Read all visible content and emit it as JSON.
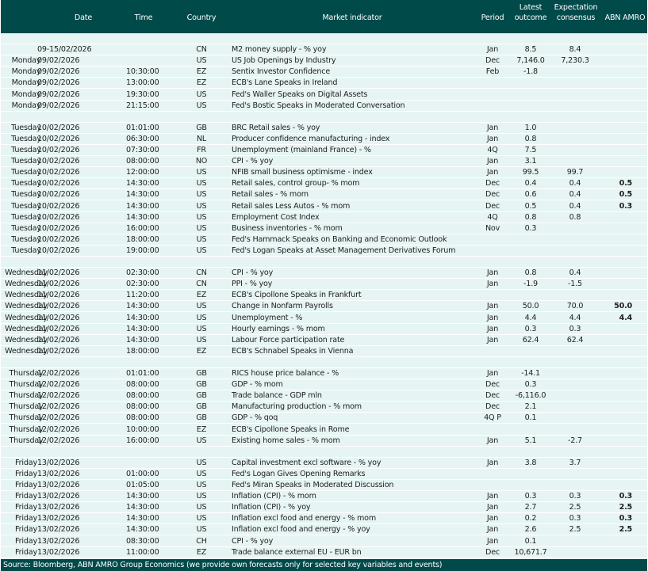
{
  "header": {
    "date": "Date",
    "time": "Time",
    "country": "Country",
    "indicator": "Market indicator",
    "period": "Period",
    "latest_l1": "Latest",
    "latest_l2": "outcome",
    "expectation_l1": "Expectation",
    "expectation_l2": "consensus",
    "abn": "ABN AMRO"
  },
  "rows": [
    {
      "day": "",
      "date": "09-15/02/2026",
      "time": "",
      "country": "CN",
      "indicator": "M2 money supply - % yoy",
      "period": "Jan",
      "latest": "8.5",
      "consensus": "8.4",
      "abn": ""
    },
    {
      "day": "Monday",
      "date": "09/02/2026",
      "time": "",
      "country": "US",
      "indicator": "US Job Openings by Industry",
      "period": "Dec",
      "latest": "7,146.0",
      "consensus": "7,230.3",
      "abn": ""
    },
    {
      "day": "Monday",
      "date": "09/02/2026",
      "time": "10:30:00",
      "country": "EZ",
      "indicator": "Sentix Investor Confidence",
      "period": "Feb",
      "latest": "-1.8",
      "consensus": "",
      "abn": ""
    },
    {
      "day": "Monday",
      "date": "09/02/2026",
      "time": "13:00:00",
      "country": "EZ",
      "indicator": "ECB's Lane Speaks in Ireland",
      "period": "",
      "latest": "",
      "consensus": "",
      "abn": ""
    },
    {
      "day": "Monday",
      "date": "09/02/2026",
      "time": "19:30:00",
      "country": "US",
      "indicator": "Fed's Waller Speaks on Digital Assets",
      "period": "",
      "latest": "",
      "consensus": "",
      "abn": ""
    },
    {
      "day": "Monday",
      "date": "09/02/2026",
      "time": "21:15:00",
      "country": "US",
      "indicator": "Fed's Bostic Speaks in Moderated Conversation",
      "period": "",
      "latest": "",
      "consensus": "",
      "abn": ""
    },
    {
      "blank": true
    },
    {
      "day": "Tuesday",
      "date": "10/02/2026",
      "time": "01:01:00",
      "country": "GB",
      "indicator": "BRC Retail sales - % yoy",
      "period": "Jan",
      "latest": "1.0",
      "consensus": "",
      "abn": ""
    },
    {
      "day": "Tuesday",
      "date": "10/02/2026",
      "time": "06:30:00",
      "country": "NL",
      "indicator": "Producer confidence manufacturing - index",
      "period": "Jan",
      "latest": "0.8",
      "consensus": "",
      "abn": ""
    },
    {
      "day": "Tuesday",
      "date": "10/02/2026",
      "time": "07:30:00",
      "country": "FR",
      "indicator": "Unemployment (mainland France) - %",
      "period": "4Q",
      "latest": "7.5",
      "consensus": "",
      "abn": ""
    },
    {
      "day": "Tuesday",
      "date": "10/02/2026",
      "time": "08:00:00",
      "country": "NO",
      "indicator": "CPI - % yoy",
      "period": "Jan",
      "latest": "3.1",
      "consensus": "",
      "abn": ""
    },
    {
      "day": "Tuesday",
      "date": "10/02/2026",
      "time": "12:00:00",
      "country": "US",
      "indicator": "NFIB small business optimisme - index",
      "period": "Jan",
      "latest": "99.5",
      "consensus": "99.7",
      "abn": ""
    },
    {
      "day": "Tuesday",
      "date": "10/02/2026",
      "time": "14:30:00",
      "country": "US",
      "indicator": "Retail sales, control group- % mom",
      "period": "Dec",
      "latest": "0.4",
      "consensus": "0.4",
      "abn": "0.5"
    },
    {
      "day": "Tuesday",
      "date": "10/02/2026",
      "time": "14:30:00",
      "country": "US",
      "indicator": "Retail sales - % mom",
      "period": "Dec",
      "latest": "0.6",
      "consensus": "0.4",
      "abn": "0.5"
    },
    {
      "day": "Tuesday",
      "date": "10/02/2026",
      "time": "14:30:00",
      "country": "US",
      "indicator": "Retail sales Less Autos - % mom",
      "period": "Dec",
      "latest": "0.5",
      "consensus": "0.4",
      "abn": "0.3"
    },
    {
      "day": "Tuesday",
      "date": "10/02/2026",
      "time": "14:30:00",
      "country": "US",
      "indicator": "Employment Cost Index",
      "period": "4Q",
      "latest": "0.8",
      "consensus": "0.8",
      "abn": ""
    },
    {
      "day": "Tuesday",
      "date": "10/02/2026",
      "time": "16:00:00",
      "country": "US",
      "indicator": "Business inventories - % mom",
      "period": "Nov",
      "latest": "0.3",
      "consensus": "",
      "abn": ""
    },
    {
      "day": "Tuesday",
      "date": "10/02/2026",
      "time": "18:00:00",
      "country": "US",
      "indicator": "Fed's Hammack Speaks on Banking and Economic Outlook",
      "period": "",
      "latest": "",
      "consensus": "",
      "abn": ""
    },
    {
      "day": "Tuesday",
      "date": "10/02/2026",
      "time": "19:00:00",
      "country": "US",
      "indicator": "Fed's Logan Speaks at Asset Management Derivatives Forum",
      "period": "",
      "latest": "",
      "consensus": "",
      "abn": ""
    },
    {
      "blank": true
    },
    {
      "day": "Wednesday",
      "date": "11/02/2026",
      "time": "02:30:00",
      "country": "CN",
      "indicator": "CPI - % yoy",
      "period": "Jan",
      "latest": "0.8",
      "consensus": "0.4",
      "abn": ""
    },
    {
      "day": "Wednesday",
      "date": "11/02/2026",
      "time": "02:30:00",
      "country": "CN",
      "indicator": "PPI - % yoy",
      "period": "Jan",
      "latest": "-1.9",
      "consensus": "-1.5",
      "abn": ""
    },
    {
      "day": "Wednesday",
      "date": "11/02/2026",
      "time": "11:20:00",
      "country": "EZ",
      "indicator": "ECB's Cipollone Speaks in Frankfurt",
      "period": "",
      "latest": "",
      "consensus": "",
      "abn": ""
    },
    {
      "day": "Wednesday",
      "date": "11/02/2026",
      "time": "14:30:00",
      "country": "US",
      "indicator": "Change in Nonfarm Payrolls",
      "period": "Jan",
      "latest": "50.0",
      "consensus": "70.0",
      "abn": "50.0"
    },
    {
      "day": "Wednesday",
      "date": "11/02/2026",
      "time": "14:30:00",
      "country": "US",
      "indicator": "Unemployment - %",
      "period": "Jan",
      "latest": "4.4",
      "consensus": "4.4",
      "abn": "4.4"
    },
    {
      "day": "Wednesday",
      "date": "11/02/2026",
      "time": "14:30:00",
      "country": "US",
      "indicator": "Hourly earnings - % mom",
      "period": "Jan",
      "latest": "0.3",
      "consensus": "0.3",
      "abn": ""
    },
    {
      "day": "Wednesday",
      "date": "11/02/2026",
      "time": "14:30:00",
      "country": "US",
      "indicator": "Labour Force participation rate",
      "period": "Jan",
      "latest": "62.4",
      "consensus": "62.4",
      "abn": ""
    },
    {
      "day": "Wednesday",
      "date": "11/02/2026",
      "time": "18:00:00",
      "country": "EZ",
      "indicator": "ECB's Schnabel Speaks in Vienna",
      "period": "",
      "latest": "",
      "consensus": "",
      "abn": ""
    },
    {
      "blank": true
    },
    {
      "day": "Thursday",
      "date": "12/02/2026",
      "time": "01:01:00",
      "country": "GB",
      "indicator": "RICS house price balance - %",
      "period": "Jan",
      "latest": "-14.1",
      "consensus": "",
      "abn": ""
    },
    {
      "day": "Thursday",
      "date": "12/02/2026",
      "time": "08:00:00",
      "country": "GB",
      "indicator": "GDP - % mom",
      "period": "Dec",
      "latest": "0.3",
      "consensus": "",
      "abn": ""
    },
    {
      "day": "Thursday",
      "date": "12/02/2026",
      "time": "08:00:00",
      "country": "GB",
      "indicator": "Trade balance - GDP mln",
      "period": "Dec",
      "latest": "-6,116.0",
      "consensus": "",
      "abn": ""
    },
    {
      "day": "Thursday",
      "date": "12/02/2026",
      "time": "08:00:00",
      "country": "GB",
      "indicator": "Manufacturing production - % mom",
      "period": "Dec",
      "latest": "2.1",
      "consensus": "",
      "abn": ""
    },
    {
      "day": "Thursday",
      "date": "12/02/2026",
      "time": "08:00:00",
      "country": "GB",
      "indicator": "GDP - % qoq",
      "period": "4Q P",
      "latest": "0.1",
      "consensus": "",
      "abn": ""
    },
    {
      "day": "Thursday",
      "date": "12/02/2026",
      "time": "10:00:00",
      "country": "EZ",
      "indicator": "ECB's Cipollone Speaks in Rome",
      "period": "",
      "latest": "",
      "consensus": "",
      "abn": ""
    },
    {
      "day": "Thursday",
      "date": "12/02/2026",
      "time": "16:00:00",
      "country": "US",
      "indicator": "Existing home sales - % mom",
      "period": "Jan",
      "latest": "5.1",
      "consensus": "-2.7",
      "abn": ""
    },
    {
      "blank": true
    },
    {
      "day": "Friday",
      "date": "13/02/2026",
      "time": "",
      "country": "US",
      "indicator": "Capital investment excl software - % yoy",
      "period": "Jan",
      "latest": "3.8",
      "consensus": "3.7",
      "abn": ""
    },
    {
      "day": "Friday",
      "date": "13/02/2026",
      "time": "01:00:00",
      "country": "US",
      "indicator": "Fed's Logan Gives Opening Remarks",
      "period": "",
      "latest": "",
      "consensus": "",
      "abn": ""
    },
    {
      "day": "Friday",
      "date": "13/02/2026",
      "time": "01:05:00",
      "country": "US",
      "indicator": "Fed's Miran Speaks in Moderated Discussion",
      "period": "",
      "latest": "",
      "consensus": "",
      "abn": ""
    },
    {
      "day": "Friday",
      "date": "13/02/2026",
      "time": "14:30:00",
      "country": "US",
      "indicator": "Inflation (CPI) - % mom",
      "period": "Jan",
      "latest": "0.3",
      "consensus": "0.3",
      "abn": "0.3"
    },
    {
      "day": "Friday",
      "date": "13/02/2026",
      "time": "14:30:00",
      "country": "US",
      "indicator": "Inflation (CPI) - % yoy",
      "period": "Jan",
      "latest": "2.7",
      "consensus": "2.5",
      "abn": "2.5"
    },
    {
      "day": "Friday",
      "date": "13/02/2026",
      "time": "14:30:00",
      "country": "US",
      "indicator": "Inflation excl food and energy - % mom",
      "period": "Jan",
      "latest": "0.2",
      "consensus": "0.3",
      "abn": "0.3"
    },
    {
      "day": "Friday",
      "date": "13/02/2026",
      "time": "14:30:00",
      "country": "US",
      "indicator": "Inflation excl food and energy - % yoy",
      "period": "Jan",
      "latest": "2.6",
      "consensus": "2.5",
      "abn": "2.5"
    },
    {
      "day": "Friday",
      "date": "13/02/2026",
      "time": "08:30:00",
      "country": "CH",
      "indicator": "CPI - % yoy",
      "period": "Jan",
      "latest": "0.1",
      "consensus": "",
      "abn": ""
    },
    {
      "day": "Friday",
      "date": "13/02/2026",
      "time": "11:00:00",
      "country": "EZ",
      "indicator": "Trade balance external EU - EUR bn",
      "period": "Dec",
      "latest": "10,671.7",
      "consensus": "",
      "abn": ""
    },
    {
      "blank": true
    }
  ],
  "footer": "Source: Bloomberg,  ABN AMRO Group Economics (we provide own forecasts only for selected key variables and events)",
  "colors": {
    "header_bg": "#014a4a",
    "body_bg": "#e6f5f3",
    "row_line": "#ffffff"
  }
}
